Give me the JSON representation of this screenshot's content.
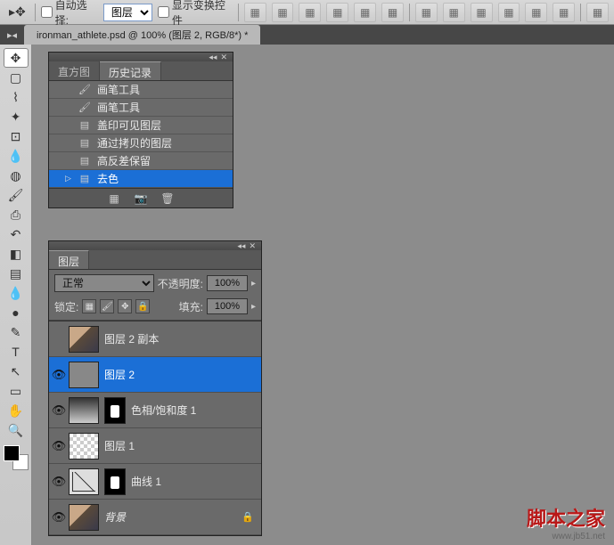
{
  "toolbar": {
    "auto_select_label": "自动选择:",
    "auto_select_dropdown": "图层",
    "show_transform_label": "显示变换控件"
  },
  "document": {
    "tab_title": "ironman_athlete.psd @ 100% (图层 2, RGB/8*) *"
  },
  "history_panel": {
    "tab_histogram": "直方图",
    "tab_history": "历史记录",
    "items": [
      {
        "icon": "brush",
        "label": "画笔工具"
      },
      {
        "icon": "brush",
        "label": "画笔工具"
      },
      {
        "icon": "doc",
        "label": "盖印可见图层"
      },
      {
        "icon": "doc",
        "label": "通过拷贝的图层"
      },
      {
        "icon": "doc",
        "label": "高反差保留"
      },
      {
        "icon": "doc",
        "label": "去色"
      }
    ]
  },
  "layers_panel": {
    "tab_layers": "图层",
    "blend_mode": "正常",
    "opacity_label": "不透明度:",
    "opacity_value": "100%",
    "lock_label": "锁定:",
    "fill_label": "填充:",
    "fill_value": "100%",
    "layers": [
      {
        "visible": false,
        "thumb": "portrait",
        "name": "图层 2 副本",
        "selected": false
      },
      {
        "visible": true,
        "thumb": "gray",
        "name": "图层 2",
        "selected": true
      },
      {
        "visible": true,
        "thumb": "grad",
        "mask": true,
        "name": "色相/饱和度 1",
        "selected": false
      },
      {
        "visible": true,
        "thumb": "checker",
        "name": "图层 1",
        "selected": false
      },
      {
        "visible": true,
        "thumb": "curve",
        "mask": true,
        "name": "曲线 1",
        "selected": false
      },
      {
        "visible": true,
        "thumb": "portrait",
        "name": "背景",
        "italic": true,
        "locked": true,
        "selected": false
      }
    ]
  },
  "watermark": {
    "text": "脚本之家",
    "url": "www.jb51.net"
  }
}
